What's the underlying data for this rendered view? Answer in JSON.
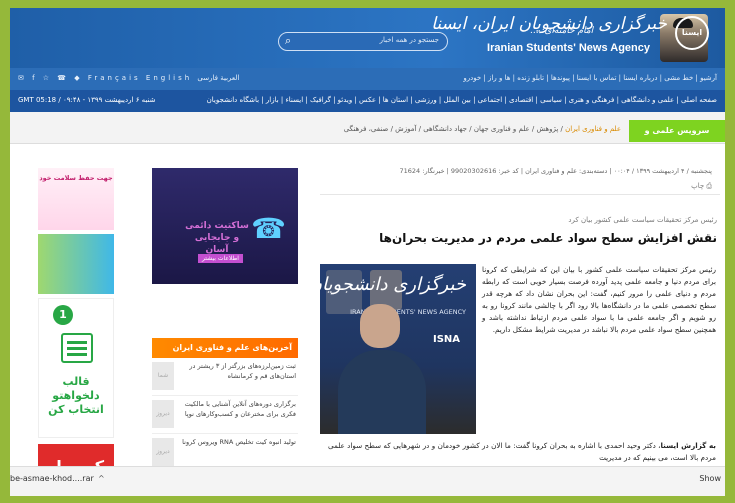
{
  "header": {
    "logo_text": "ایسنا",
    "brand_fa": "خبرگزاری دانشجویان ایران، ایسنا",
    "brand_en": "Iranian Students' News Agency",
    "search_placeholder": "جستجو در همه اخبار",
    "quote": "امام خامنه‌ای: ...",
    "social": "✉ f ☆ ☎ ◆ Français  English  العربية  فارسی",
    "toplinks": "آرشیو | خط مشی | درباره ایسنا | تماس با ایسنا | پیوندها | تابلو زنده | ها و راز | خودرو"
  },
  "nav": {
    "date": "GMT 05:18 / ۰۹:۴۸ - شنبه ۶ اردیبهشت ۱۳۹۹",
    "items": "صفحه اصلی | علمی و دانشگاهی | فرهنگی و هنری | سیاسی | اقتصادی | اجتماعی | بین الملل | ورزشی | استان ها | عکس | ویدئو | گرافیک | ایسناء | بازار | باشگاه دانشجویان",
    "service": "سرویس علمی و دانشگاهی",
    "sub_active": "علم و فناوری ایران",
    "sub_rest": " / پژوهش / علم و فناوری جهان / جهاد دانشگاهی / آموزش / صنفی، فرهنگی"
  },
  "article": {
    "meta": "پنجشنبه / ۴ اردیبهشت ۱۳۹۹ / ۰۰:۰۴ | دسته‌بندی: علم و فناوری ایران | کد خبر: 99020302616 | خبرنگار: 71624",
    "code_label": "کد خبر",
    "print": "⎙ چاپ",
    "lead": "رئیس مرکز تحقیقات سیاست علمی کشور بیان کرد",
    "title": "نقش افزایش سطح سواد علمی مردم در مدیریت بحران‌ها",
    "photo_brand": "خبرگزاری دانشجویان ایران",
    "photo_en": "IRANIAN STUDENTS' NEWS AGENCY",
    "photo_isna": "ISNA",
    "body": "رئیس مرکز تحقیقات سیاست علمی کشور با بیان این که شرایطی که کرونا برای مردم دنیا و جامعه علمی پدید آورده فرصت بسیار خوبی است که رابطه مردم و دنیای علمی را مرور کنیم، گفت: این بحران نشان داد که هرچه قدر سطح تخصصی علمی ما در دانشگاه‌ها بالا رود اگر با چالشی مانند کرونا رو به رو شویم و اگر جامعه علمی ما با سواد علمی مردم ارتباط نداشته باشد و همچنین سطح سواد علمی مردم بالا نباشد در مدیریت شرایط مشکل داریم.",
    "body2_bold": "به گزارش ایسنا",
    "body2": "، دکتر وحید احمدی با اشاره به بحران کرونا گفت: ما الان در کشور خودمان و در شهرهایی که سطح سواد علمی مردم بالا است، می بینیم که در مدیریت"
  },
  "ads": {
    "cloud_text": "ساکتیت دائمی و جابجایی آسان",
    "cloud_btn": "اطلاعات بیشتر",
    "cloud_icon": "phone-icon",
    "ad1": "جهت حفظ سلامت خود",
    "ad3_num": "1",
    "ad3_text": "قالب دلخواهتو انتخاب کن",
    "ad4": "کپسول"
  },
  "latest": {
    "head": "آخرین‌های علم و فناوری ایران",
    "items": [
      {
        "thumb": "شما",
        "text": "ثبت زمین‌لرزه‌های بزرگتر از ۳ ریشتر در استان‌های قم و کرمانشاه"
      },
      {
        "thumb": "دیروز",
        "text": "برگزاری دوره‌های آنلاین آشنایی با مالکیت فکری برای مخترعان و کسب‌وکارهای نوپا"
      },
      {
        "thumb": "دیروز",
        "text": "تولید انبوه کیت تخلیص RNA ویروس کرونا"
      }
    ]
  },
  "downloads": {
    "file": "be-asmae-khod....rar",
    "chevron": "^",
    "show_all": "Show"
  }
}
